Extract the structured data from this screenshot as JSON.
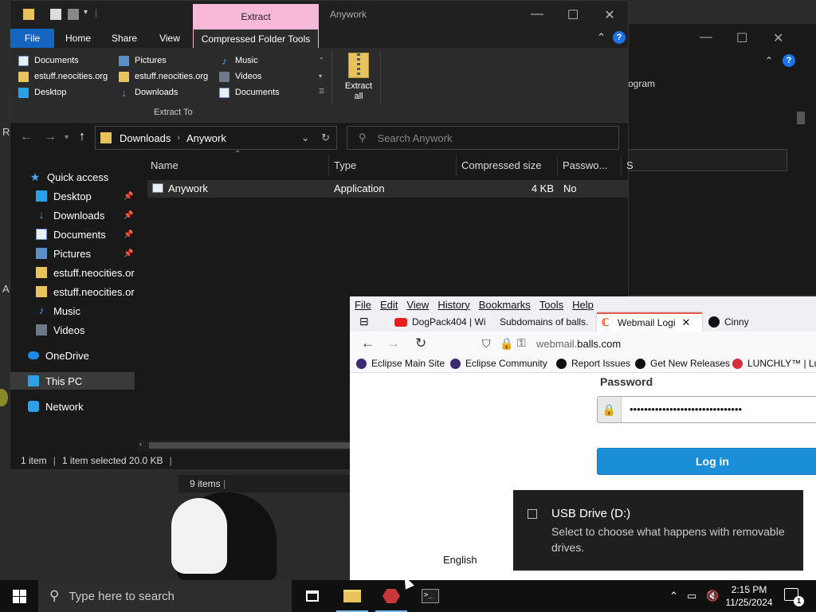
{
  "explorer": {
    "title": "Anywork",
    "context_tab": "Extract",
    "ribbon_tabs": [
      "File",
      "Home",
      "Share",
      "View",
      "Compressed Folder Tools"
    ],
    "extract_items": [
      {
        "label": "Documents",
        "icon": "document-icon"
      },
      {
        "label": "estuff.neocities.org",
        "icon": "folder-icon"
      },
      {
        "label": "Desktop",
        "icon": "desktop-icon"
      },
      {
        "label": "Pictures",
        "icon": "pictures-icon"
      },
      {
        "label": "estuff.neocities.org",
        "icon": "folder-icon"
      },
      {
        "label": "Downloads",
        "icon": "download-icon"
      },
      {
        "label": "Music",
        "icon": "music-icon"
      },
      {
        "label": "Videos",
        "icon": "video-icon"
      },
      {
        "label": "Documents",
        "icon": "document-icon"
      }
    ],
    "extract_all_line1": "Extract",
    "extract_all_line2": "all",
    "extract_to_label": "Extract To",
    "breadcrumb": [
      "Downloads",
      "Anywork"
    ],
    "search_placeholder": "Search Anywork",
    "nav": {
      "quick_access": "Quick access",
      "items": [
        "Desktop",
        "Downloads",
        "Documents",
        "Pictures",
        "estuff.neocities.or",
        "estuff.neocities.or",
        "Music",
        "Videos"
      ],
      "onedrive": "OneDrive",
      "this_pc": "This PC",
      "network": "Network"
    },
    "columns": [
      "Name",
      "Type",
      "Compressed size",
      "Passwo...",
      "S"
    ],
    "files": [
      {
        "name": "Anywork",
        "type": "Application",
        "size": "4 KB",
        "password": "No"
      }
    ],
    "status": {
      "items": "1 item",
      "selected": "1 item selected  20.0 KB"
    },
    "behind_status": "9 items"
  },
  "back_window": {
    "partial_text": "ogram"
  },
  "browser": {
    "menu": [
      "File",
      "Edit",
      "View",
      "History",
      "Bookmarks",
      "Tools",
      "Help"
    ],
    "tabs": [
      {
        "label": "DogPack404 | Wi"
      },
      {
        "label": "Subdomains of balls."
      },
      {
        "label": "Webmail Logi"
      },
      {
        "label": "Cinny"
      }
    ],
    "url_prefix": "webmail.",
    "url_domain": "balls.com",
    "bookmarks": [
      "Eclipse Main Site",
      "Eclipse Community",
      "Report Issues",
      "Get New Releases",
      "LUNCHLY™ | Lun"
    ],
    "password_label": "Password",
    "password_value": "•••••••••••••••••••••••••••••••",
    "login_button": "Log in",
    "language": "English"
  },
  "toast": {
    "title": "USB Drive (D:)",
    "body": "Select to choose what happens with removable drives."
  },
  "taskbar": {
    "search_placeholder": "Type here to search",
    "time": "2:15 PM",
    "date": "11/25/2024",
    "notification_count": "1"
  },
  "colors": {
    "file_tab": "#1565c0",
    "context_tab": "#f8b8d8",
    "login_button": "#1a8fd7",
    "active_tab_accent": "#e25b4f"
  }
}
